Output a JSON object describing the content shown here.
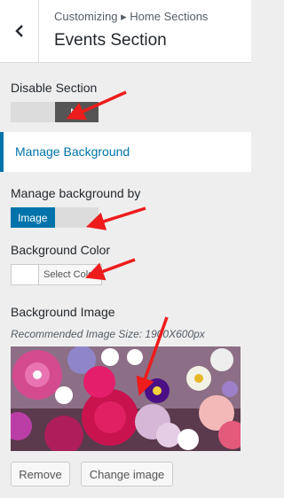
{
  "header": {
    "breadcrumb": "Customizing ▸ Home Sections",
    "title": "Events Section",
    "back_icon": "chevron-left-icon"
  },
  "disable_section": {
    "label": "Disable Section",
    "selected_option": "No"
  },
  "manage_panel": {
    "label": "Manage Background"
  },
  "manage_by": {
    "label": "Manage background by",
    "selected_option": "Image"
  },
  "background_color": {
    "label": "Background Color",
    "button_label": "Select Color",
    "value": "#ffffff"
  },
  "background_image": {
    "label": "Background Image",
    "recommended": "Recommended Image Size: 1900X600px",
    "remove_label": "Remove",
    "change_label": "Change image"
  },
  "colors": {
    "accent": "#0073aa",
    "arrow": "#ee1c1c"
  }
}
